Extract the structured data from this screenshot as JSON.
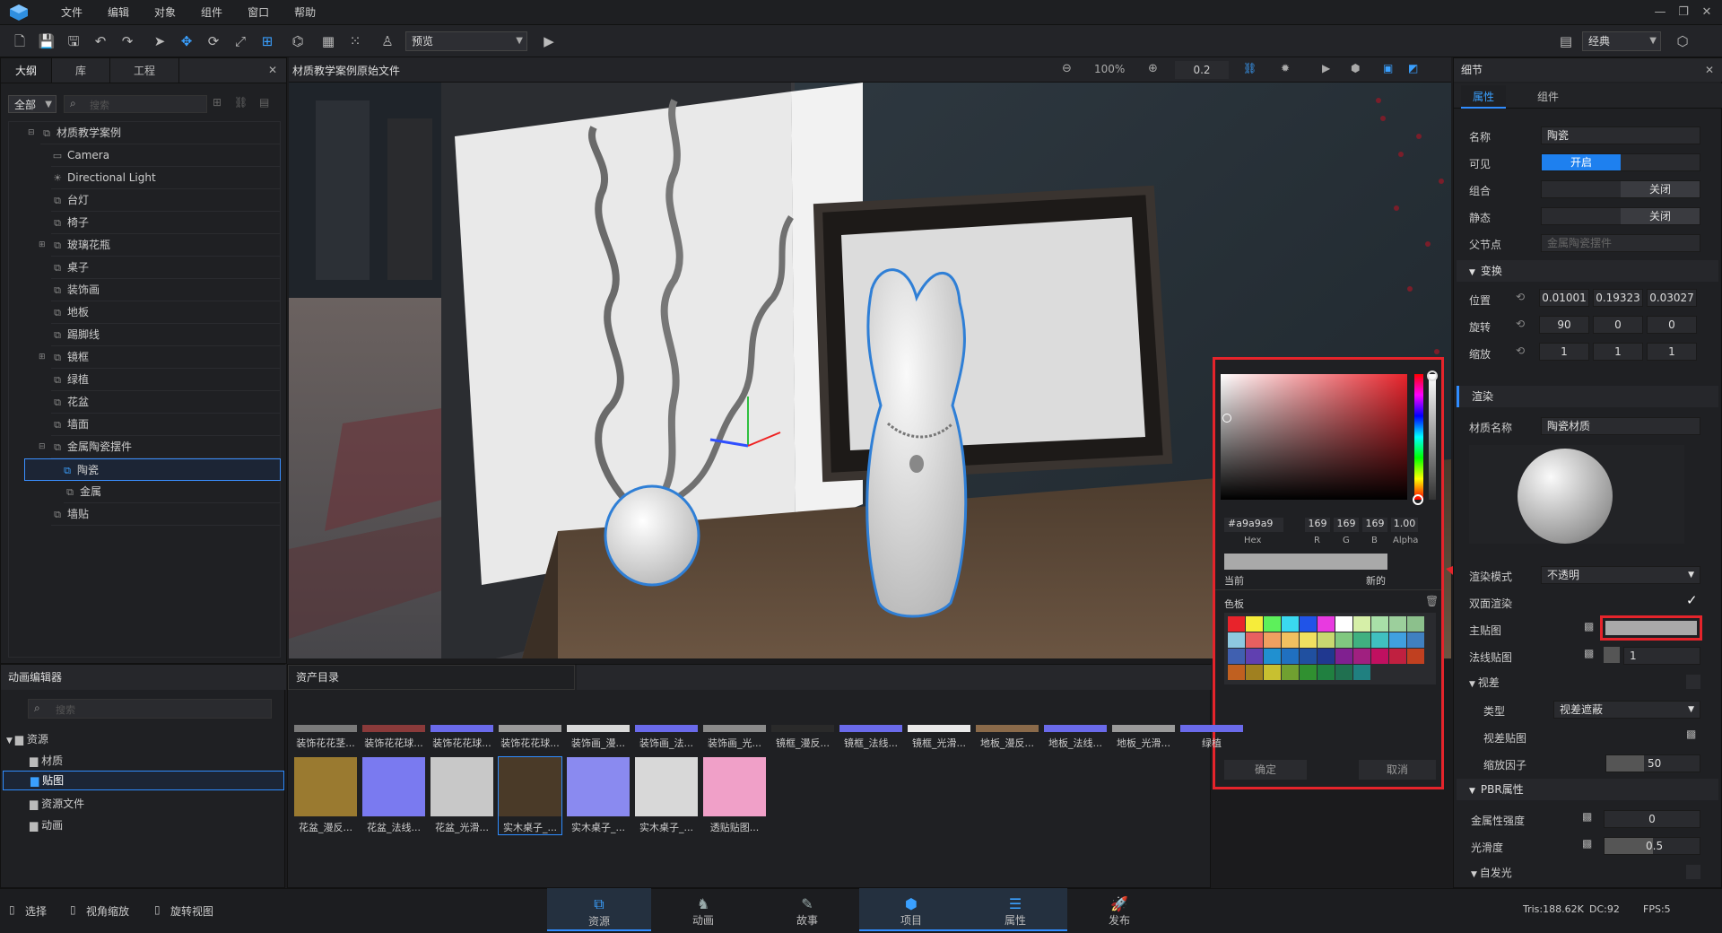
{
  "menu": [
    "文件",
    "编辑",
    "对象",
    "组件",
    "窗口",
    "帮助"
  ],
  "toolbar": {
    "preview_label": "预览",
    "layout_label": "经典"
  },
  "outline": {
    "tabs": [
      "大纲",
      "库",
      "工程"
    ],
    "filter": "全部",
    "search_placeholder": "搜索",
    "items": [
      "材质教学案例",
      "Camera",
      "Directional Light",
      "台灯",
      "椅子",
      "玻璃花瓶",
      "桌子",
      "装饰画",
      "地板",
      "踢脚线",
      "镜框",
      "绿植",
      "花盆",
      "墙面",
      "金属陶瓷摆件",
      "陶瓷",
      "金属",
      "墙贴"
    ]
  },
  "viewport": {
    "title": "材质教学案例原始文件",
    "zoom": "100%",
    "speed": "0.2"
  },
  "anim": {
    "title": "动画编辑器",
    "search_placeholder": "搜索",
    "tree": [
      "资源",
      "材质",
      "贴图",
      "资源文件",
      "动画"
    ]
  },
  "assets": {
    "title": "资产目录",
    "row1": [
      "装饰花花茎...",
      "装饰花花球...",
      "装饰花花球...",
      "装饰花花球...",
      "装饰画_漫...",
      "装饰画_法...",
      "装饰画_光...",
      "镜框_漫反...",
      "镜框_法线...",
      "镜框_光滑...",
      "地板_漫反...",
      "地板_法线...",
      "地板_光滑...",
      "绿植"
    ],
    "row2": [
      "花盆_漫反...",
      "花盆_法线...",
      "花盆_光滑...",
      "实木桌子_...",
      "实木桌子_...",
      "实木桌子_...",
      "透贴贴图..."
    ]
  },
  "color_picker": {
    "hex": "#a9a9a9",
    "r": "169",
    "g": "169",
    "b": "169",
    "alpha": "1.00",
    "hex_label": "Hex",
    "r_label": "R",
    "g_label": "G",
    "b_label": "B",
    "alpha_label": "Alpha",
    "current": "当前",
    "new": "新的",
    "palette_label": "色板",
    "ok": "确定",
    "cancel": "取消",
    "swatches": [
      "#e8232b",
      "#f6ec3a",
      "#5df05b",
      "#3ad8f0",
      "#2054e8",
      "#e83ae0",
      "#ffffff",
      "#d6efa8",
      "#a8e0a8",
      "#9ccf9c",
      "#8cc08c",
      "#8ec8e0",
      "#e86060",
      "#f0a060",
      "#f0c060",
      "#f0e060",
      "#c8d870",
      "#80c880",
      "#40b080",
      "#40c0c0",
      "#40a0e0",
      "#4080c0",
      "#4060b0",
      "#6040b0",
      "#2090d0",
      "#2070c0",
      "#2050a0",
      "#203890",
      "#802090",
      "#a02080",
      "#c01060",
      "#c02040",
      "#c04020",
      "#c06020",
      "#a08020",
      "#c8c030",
      "#70a030",
      "#309030",
      "#208040",
      "#207050",
      "#208080"
    ]
  },
  "details": {
    "title": "细节",
    "tabs": [
      "属性",
      "组件"
    ],
    "name_label": "名称",
    "name_value": "陶瓷",
    "visible_label": "可见",
    "visible_value": "开启",
    "group_label": "组合",
    "group_value": "关闭",
    "static_label": "静态",
    "static_value": "关闭",
    "parent_label": "父节点",
    "parent_value": "金属陶瓷摆件",
    "transform_label": "变换",
    "pos_label": "位置",
    "rot_label": "旋转",
    "scale_label": "缩放",
    "pos": [
      "0.01001",
      "0.19323",
      "0.03027"
    ],
    "rot": [
      "90",
      "0",
      "0"
    ],
    "scale": [
      "1",
      "1",
      "1"
    ],
    "render_label": "渲染",
    "material_label": "材质名称",
    "material_value": "陶瓷材质",
    "render_mode_label": "渲染模式",
    "render_mode_value": "不透明",
    "double_label": "双面渲染",
    "main_tex_label": "主贴图",
    "normal_label": "法线贴图",
    "normal_value": "1",
    "parallax_label": "视差",
    "type_label": "类型",
    "type_value": "视差遮蔽",
    "parallax_tex_label": "视差贴图",
    "scale_factor_label": "缩放因子",
    "scale_factor_value": "50",
    "pbr_label": "PBR属性",
    "metal_label": "金属性强度",
    "metal_value": "0",
    "smooth_label": "光滑度",
    "smooth_value": "0.5",
    "emission_label": "自发光"
  },
  "status": {
    "select": "选择",
    "zoom": "视角缩放",
    "rotate": "旋转视图",
    "tris": "Tris:188.62K",
    "dc": "DC:92",
    "fps": "FPS:5"
  },
  "bottom_tabs": [
    "资源",
    "动画",
    "故事",
    "项目",
    "属性",
    "发布"
  ]
}
